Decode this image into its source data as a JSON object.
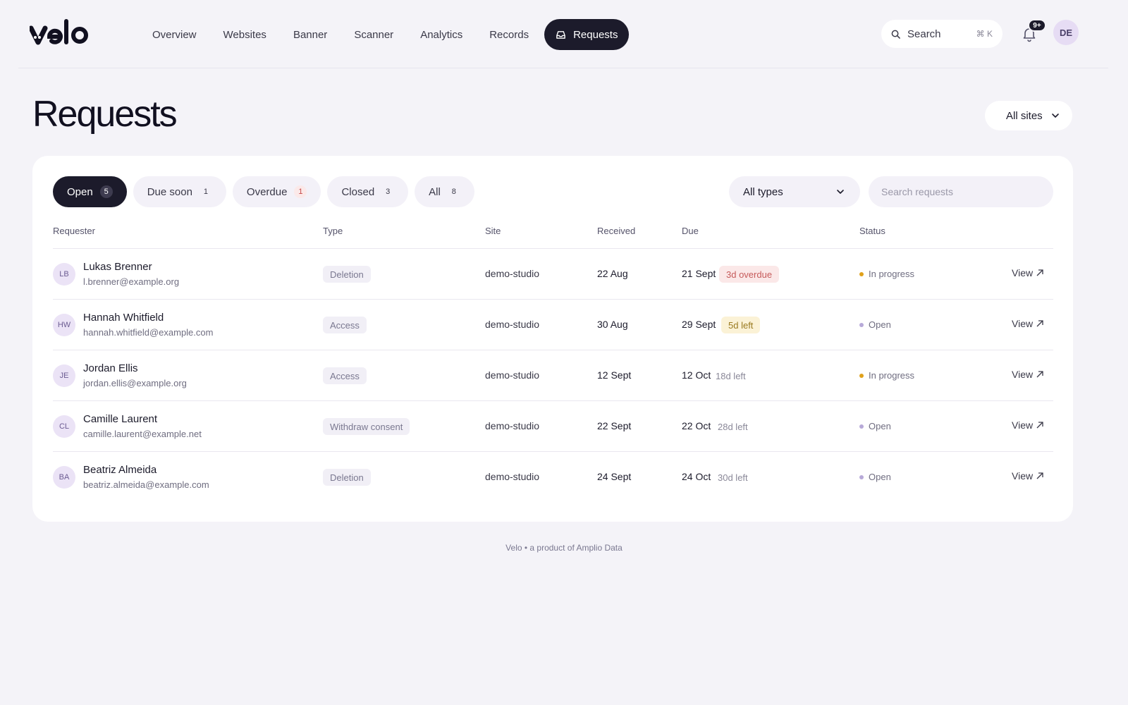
{
  "nav": {
    "items": [
      "Overview",
      "Websites",
      "Banner",
      "Scanner",
      "Analytics",
      "Records"
    ],
    "active": "Requests"
  },
  "search": {
    "label": "Search",
    "shortcut": "⌘ K"
  },
  "notifications": {
    "count": "9+"
  },
  "user": {
    "initials": "DE"
  },
  "page": {
    "title": "Requests",
    "site_filter": "All sites"
  },
  "tabs": [
    {
      "label": "Open",
      "count": "5"
    },
    {
      "label": "Due soon",
      "count": "1"
    },
    {
      "label": "Overdue",
      "count": "1"
    },
    {
      "label": "Closed",
      "count": "3"
    },
    {
      "label": "All",
      "count": "8"
    }
  ],
  "filters": {
    "type": "All types",
    "search_placeholder": "Search requests"
  },
  "columns": [
    "Requester",
    "Type",
    "Site",
    "Received",
    "Due",
    "Status"
  ],
  "rows": [
    {
      "initials": "LB",
      "name": "Lukas Brenner",
      "email": "l.brenner@example.org",
      "type": "Deletion",
      "site": "demo-studio",
      "received": "22 Aug",
      "due": "21 Sept",
      "due_note": "3d overdue",
      "status": "In progress",
      "action": "View"
    },
    {
      "initials": "HW",
      "name": "Hannah Whitfield",
      "email": "hannah.whitfield@example.com",
      "type": "Access",
      "site": "demo-studio",
      "received": "30 Aug",
      "due": "29 Sept",
      "due_note": "5d left",
      "status": "Open",
      "action": "View"
    },
    {
      "initials": "JE",
      "name": "Jordan Ellis",
      "email": "jordan.ellis@example.org",
      "type": "Access",
      "site": "demo-studio",
      "received": "12 Sept",
      "due": "12 Oct",
      "due_note": "18d left",
      "status": "In progress",
      "action": "View"
    },
    {
      "initials": "CL",
      "name": "Camille Laurent",
      "email": "camille.laurent@example.net",
      "type": "Withdraw consent",
      "site": "demo-studio",
      "received": "22 Sept",
      "due": "22 Oct",
      "due_note": "28d left",
      "status": "Open",
      "action": "View"
    },
    {
      "initials": "BA",
      "name": "Beatriz Almeida",
      "email": "beatriz.almeida@example.com",
      "type": "Deletion",
      "site": "demo-studio",
      "received": "24 Sept",
      "due": "24 Oct",
      "due_note": "30d left",
      "status": "Open",
      "action": "View"
    }
  ],
  "footer": "Velo • a product of Amplio Data",
  "colors": {
    "dark": "#1c1b2b",
    "overdue": "#c65a5a",
    "due_soon": "#9a7a20",
    "in_progress": "#e0a11b",
    "open": "#b7a9d8"
  }
}
